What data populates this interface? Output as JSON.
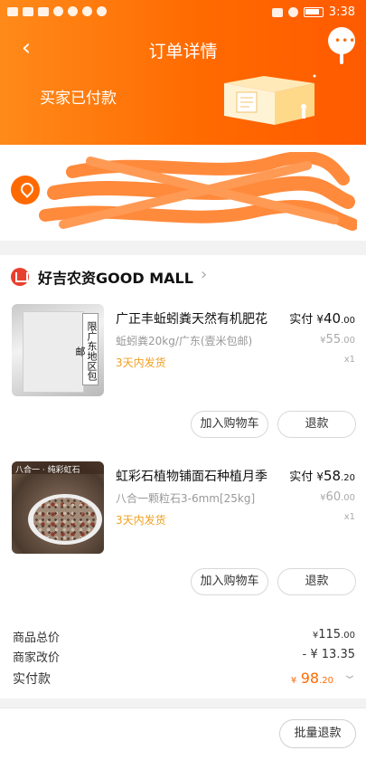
{
  "status_bar": {
    "time": "3:38"
  },
  "header": {
    "title": "订单详情",
    "back_icon": "back-arrow-icon",
    "more_icon": "more-dots-icon",
    "status": "买家已付款"
  },
  "store": {
    "name": "好吉农资GOOD MALL"
  },
  "items": [
    {
      "title": "广正丰蚯蚓粪天然有机肥花",
      "spec": "蚯蚓粪20kg/广东(壹米包邮)",
      "shipping": "3天内发货",
      "paid_label": "实付",
      "paid_currency": "¥",
      "paid_int": "40",
      "paid_dec": ".00",
      "orig_currency": "¥",
      "orig_int": "55",
      "orig_dec": ".00",
      "qty": "x1",
      "thumb_tag": "限广东地区包邮",
      "cart_button": "加入购物车",
      "refund_button": "退款"
    },
    {
      "title": "虹彩石植物铺面石种植月季",
      "spec": "八合一颗粒石3-6mm[25kg]",
      "shipping": "3天内发货",
      "paid_label": "实付",
      "paid_currency": "¥",
      "paid_int": "58",
      "paid_dec": ".20",
      "orig_currency": "¥",
      "orig_int": "60",
      "orig_dec": ".00",
      "qty": "x1",
      "thumb_tag": "八合一 · 纯彩虹石",
      "cart_button": "加入购物车",
      "refund_button": "退款"
    }
  ],
  "totals": {
    "goods_label": "商品总价",
    "goods_currency": "¥",
    "goods_int": "115",
    "goods_dec": ".00",
    "adjust_label": "商家改价",
    "adjust_value": "- ¥ 13.35",
    "pay_label": "实付款",
    "pay_currency": "¥",
    "pay_int": "98",
    "pay_dec": ".20"
  },
  "footer": {
    "batch_refund": "批量退款"
  },
  "colors": {
    "accent": "#ff6a00",
    "shipping": "#f0a020"
  }
}
